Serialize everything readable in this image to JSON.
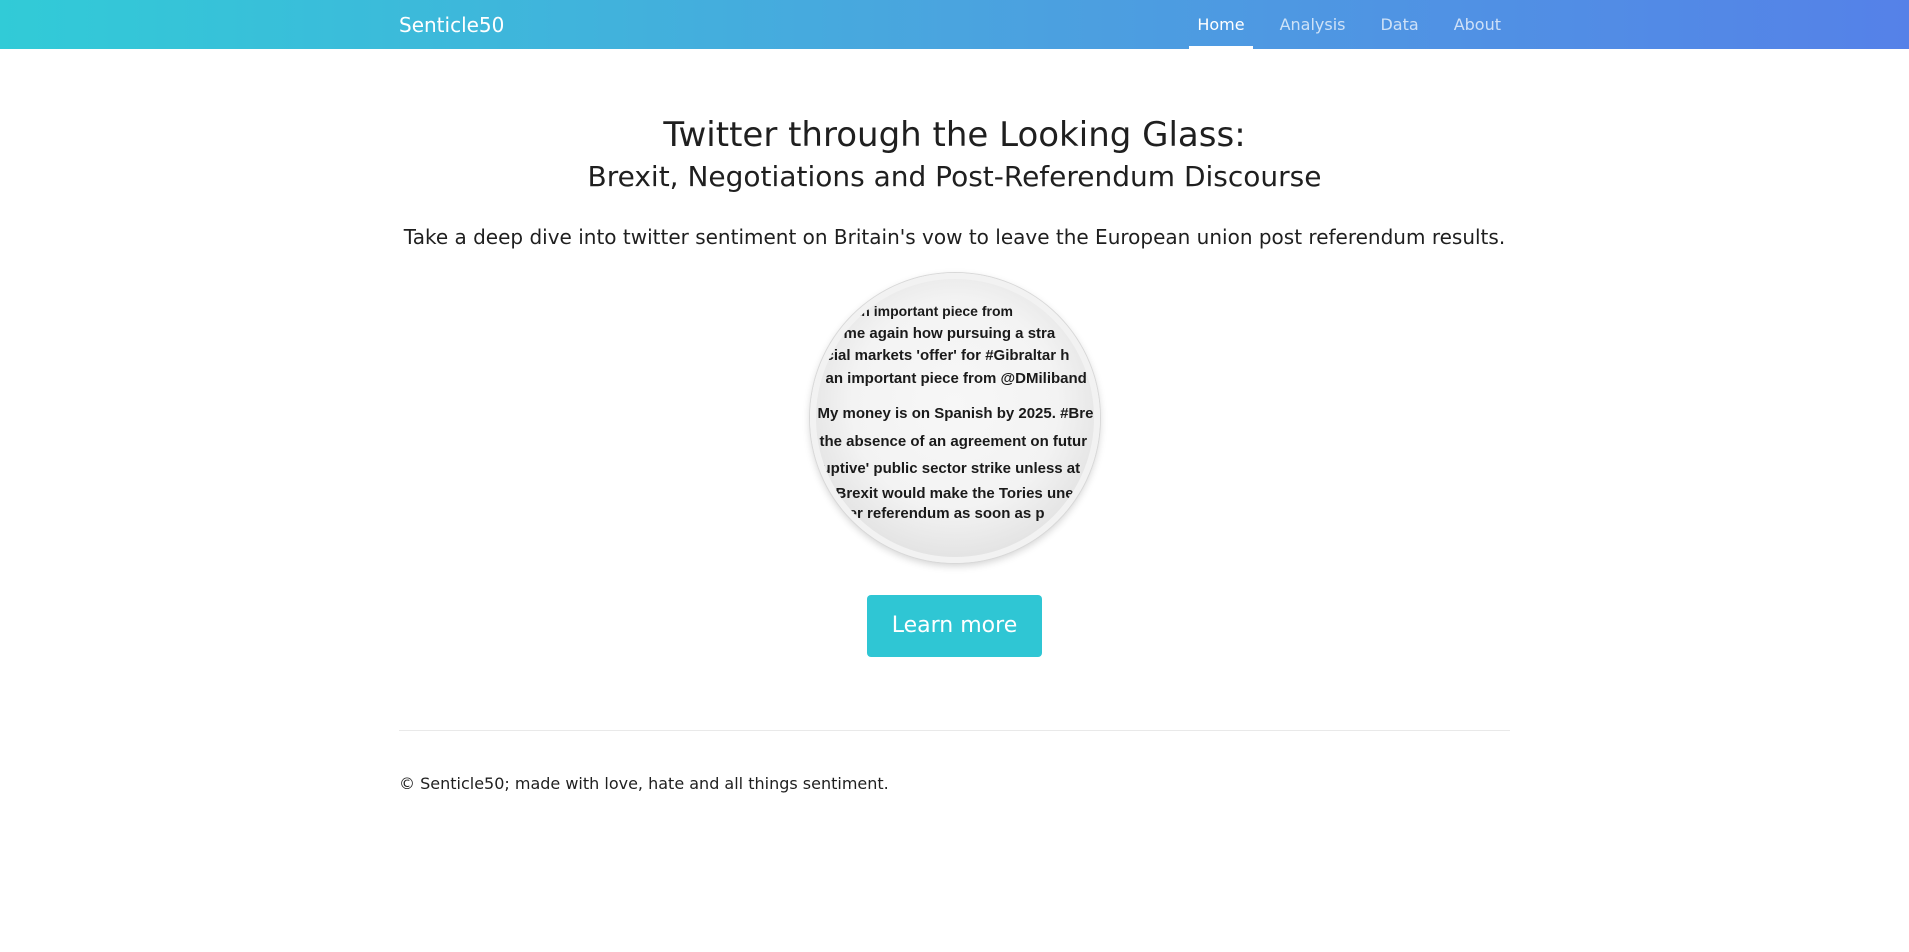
{
  "nav": {
    "brand": "Senticle50",
    "items": [
      {
        "label": "Home",
        "active": true
      },
      {
        "label": "Analysis",
        "active": false
      },
      {
        "label": "Data",
        "active": false
      },
      {
        "label": "About",
        "active": false
      }
    ]
  },
  "hero": {
    "title": "Twitter through the Looking Glass:",
    "subtitle": "Brexit, Negotiations and Post-Referendum Discourse",
    "lead": "Take a deep dive into twitter sentiment on Britain's vow to leave the European union post referendum results.",
    "magnifier_lines": [
      "an important piece from",
      "me again how pursuing a stra",
      "cial markets 'offer' for #Gibraltar h",
      "an important piece from @DMiliband",
      "My money is on Spanish by 2025. #Bre",
      "the absence of an agreement on futur",
      "uptive' public sector strike unless at",
      "Brexit would make the Tories une",
      "her referendum as soon as p"
    ],
    "button_label": "Learn more"
  },
  "footer": {
    "text": "© Senticle50; made with love, hate and all things sentiment."
  },
  "colors": {
    "navbar_left": "#31cbd7",
    "navbar_right": "#5581e8",
    "button": "#2fc6d4"
  }
}
